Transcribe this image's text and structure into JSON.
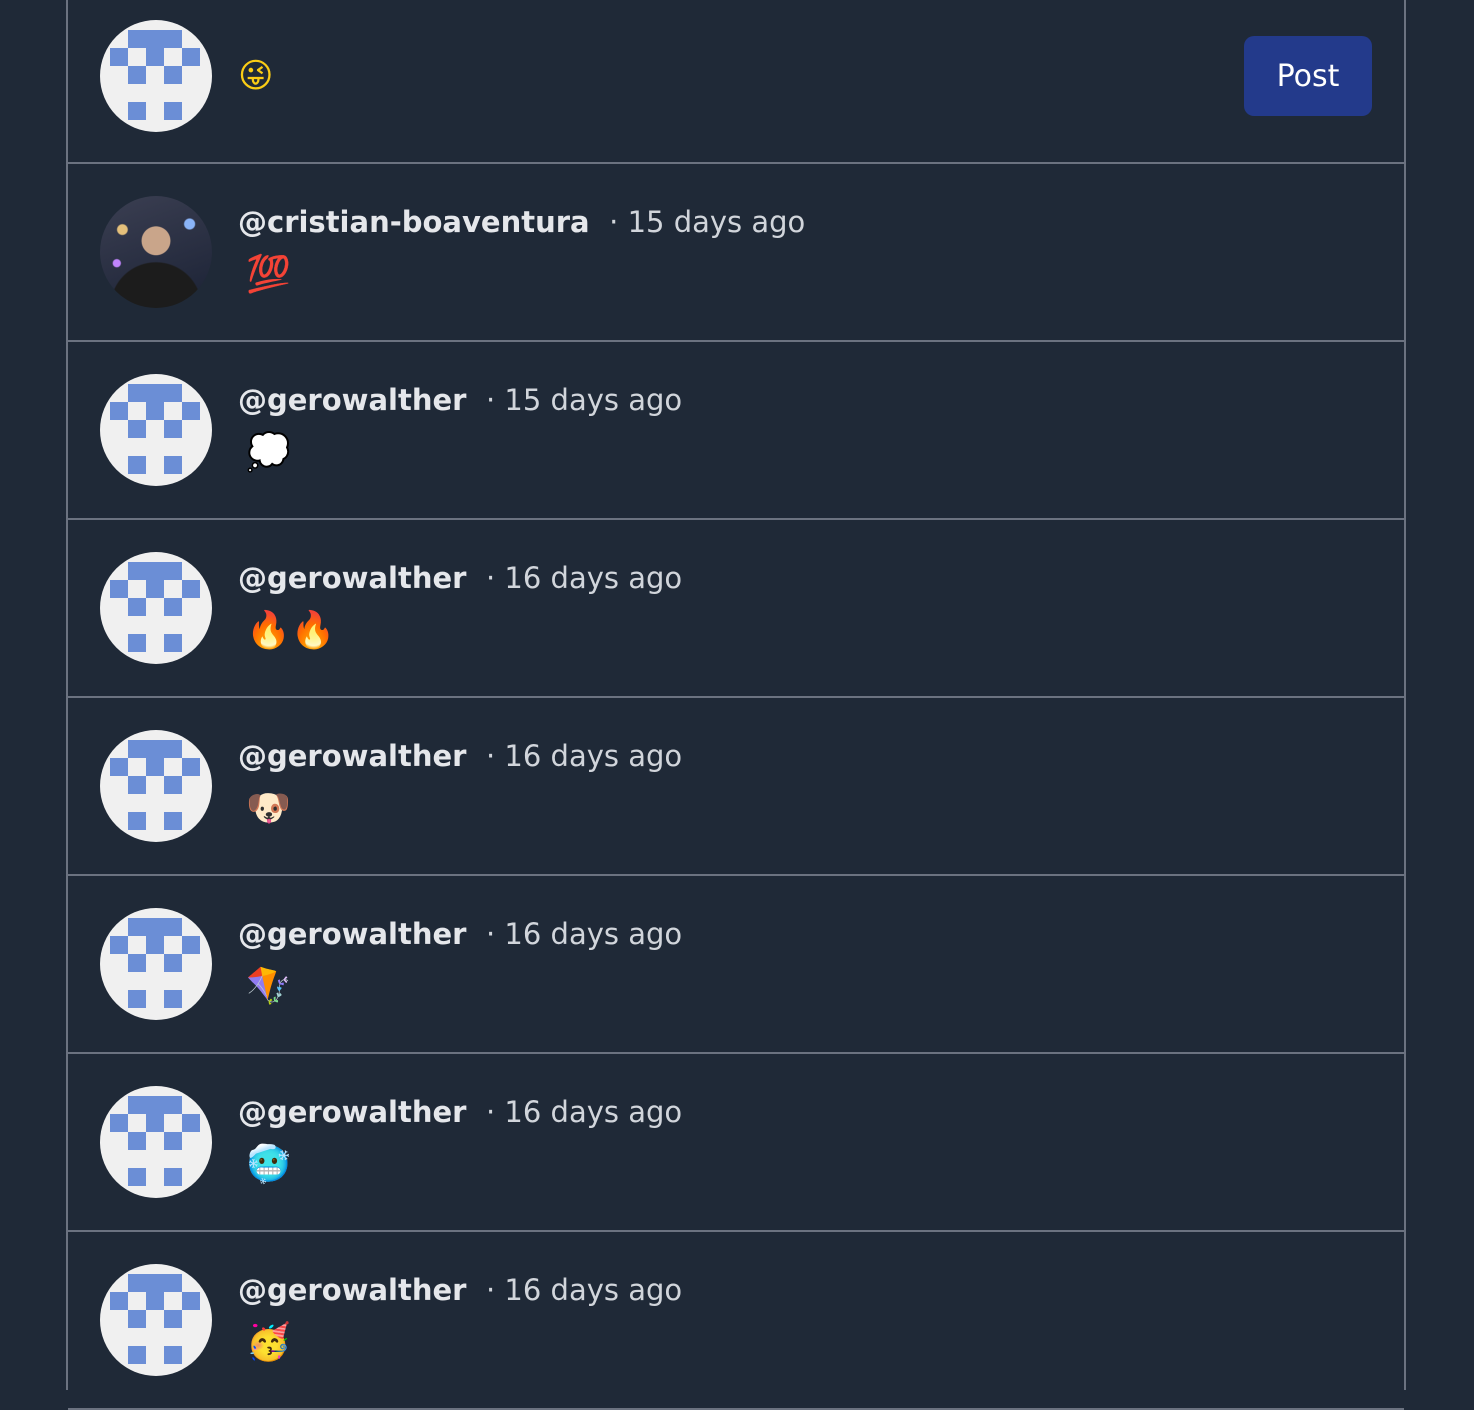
{
  "composer": {
    "text": "😜",
    "post_label": "Post"
  },
  "posts": [
    {
      "username": "@cristian-boaventura",
      "time": "· 15 days ago",
      "content": "💯",
      "avatar": "photo"
    },
    {
      "username": "@gerowalther",
      "time": "· 15 days ago",
      "content": "💭",
      "avatar": "identicon"
    },
    {
      "username": "@gerowalther",
      "time": "· 16 days ago",
      "content": "🔥🔥",
      "avatar": "identicon"
    },
    {
      "username": "@gerowalther",
      "time": "· 16 days ago",
      "content": "🐶",
      "avatar": "identicon"
    },
    {
      "username": "@gerowalther",
      "time": "· 16 days ago",
      "content": "🪁",
      "avatar": "identicon"
    },
    {
      "username": "@gerowalther",
      "time": "· 16 days ago",
      "content": "🥶",
      "avatar": "identicon"
    },
    {
      "username": "@gerowalther",
      "time": "· 16 days ago",
      "content": "🥳",
      "avatar": "identicon"
    }
  ],
  "colors": {
    "background": "#1f2937",
    "button": "#233a8b",
    "identicon": "#6b8ed6",
    "border": "#6b7280"
  }
}
